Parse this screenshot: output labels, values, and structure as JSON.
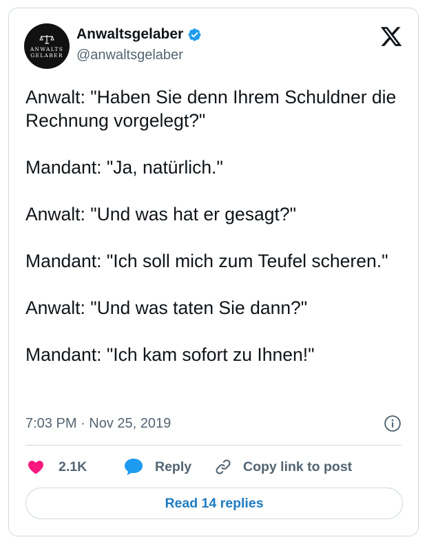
{
  "author": {
    "avatar_line1": "ANWALTS",
    "avatar_line2": "GELABER",
    "name": "Anwaltsgelaber",
    "handle": "@anwaltsgelaber",
    "verified": true
  },
  "post": {
    "paragraphs": [
      "Anwalt: \"Haben Sie denn Ihrem Schuldner die Rechnung vorgelegt?\"",
      "Mandant: \"Ja, natürlich.\"",
      "Anwalt: \"Und was hat er gesagt?\"",
      "Mandant: \"Ich soll mich zum Teufel scheren.\"",
      "Anwalt: \"Und was taten Sie dann?\"",
      "Mandant: \"Ich kam sofort zu Ihnen!\""
    ],
    "timestamp": "7:03 PM · Nov 25, 2019"
  },
  "actions": {
    "likes": "2.1K",
    "reply_label": "Reply",
    "copy_label": "Copy link to post"
  },
  "read_replies_label": "Read 14 replies",
  "icons": {
    "logo": "x-logo-icon",
    "verified": "verified-badge-icon",
    "info": "info-icon",
    "like": "heart-icon",
    "reply": "speech-bubble-icon",
    "copy": "link-icon"
  },
  "colors": {
    "like": "#f91880",
    "reply_bubble": "#1d9bf0",
    "verified": "#1d9bf0",
    "button_text": "#1d7bc1"
  }
}
